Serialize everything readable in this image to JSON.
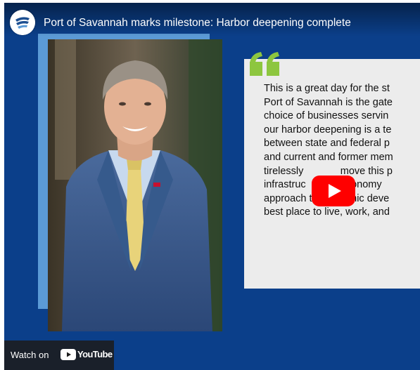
{
  "video": {
    "title": "Port of Savannah marks milestone: Harbor deepening complete"
  },
  "quote": {
    "lines": [
      "This is a great day for the st",
      "Port of Savannah is the gate",
      "choice of businesses servin",
      "our harbor deepening is a te",
      "between state and federal p",
      "and current and former mem",
      "tirelessly             move this p",
      "infrastruc          r economy",
      "approach to economic deve",
      "best place to live, work, and"
    ]
  },
  "player": {
    "watch_on_label": "Watch on",
    "youtube_label": "YouTube"
  },
  "colors": {
    "background_blue": "#0b3f8a",
    "accent_light_blue": "#5b9ad6",
    "quote_card": "#ececec",
    "quote_mark_green": "#8dc63f",
    "play_red": "#ff0000"
  },
  "icons": {
    "channel_logo": "georgia-ports-logo",
    "quote_mark": "quote-mark-icon",
    "play": "play-icon",
    "youtube": "youtube-icon"
  }
}
